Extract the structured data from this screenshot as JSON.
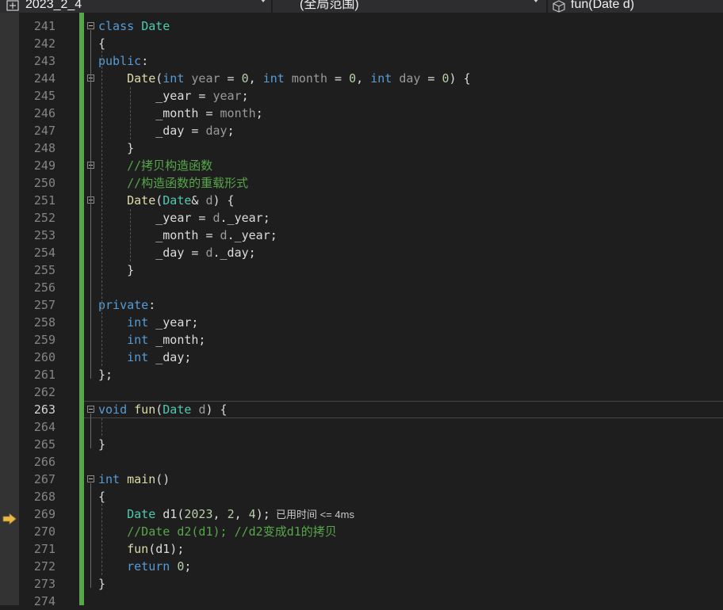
{
  "navbar": {
    "project": "2023_2_4",
    "scope": "(全局范围)",
    "member": "fun(Date d)"
  },
  "editor": {
    "current_line": 263,
    "execution_line": 269,
    "elapsed_hint": "已用时间 <= 4ms",
    "lines": [
      {
        "no": "241",
        "tokens": [
          [
            "kw",
            "class"
          ],
          [
            "pl",
            " "
          ],
          [
            "ty",
            "Date"
          ]
        ]
      },
      {
        "no": "242",
        "tokens": [
          [
            "pl",
            "{"
          ]
        ]
      },
      {
        "no": "243",
        "tokens": [
          [
            "kw",
            "public"
          ],
          [
            "pl",
            ":"
          ]
        ]
      },
      {
        "no": "244",
        "tokens": [
          [
            "pl",
            "    "
          ],
          [
            "fn",
            "Date"
          ],
          [
            "pl",
            "("
          ],
          [
            "kw",
            "int"
          ],
          [
            "pl",
            " "
          ],
          [
            "pm",
            "year"
          ],
          [
            "pl",
            " = "
          ],
          [
            "nm",
            "0"
          ],
          [
            "pl",
            ", "
          ],
          [
            "kw",
            "int"
          ],
          [
            "pl",
            " "
          ],
          [
            "pm",
            "month"
          ],
          [
            "pl",
            " = "
          ],
          [
            "nm",
            "0"
          ],
          [
            "pl",
            ", "
          ],
          [
            "kw",
            "int"
          ],
          [
            "pl",
            " "
          ],
          [
            "pm",
            "day"
          ],
          [
            "pl",
            " = "
          ],
          [
            "nm",
            "0"
          ],
          [
            "pl",
            ") {"
          ]
        ]
      },
      {
        "no": "245",
        "tokens": [
          [
            "pl",
            "        _year = "
          ],
          [
            "pm",
            "year"
          ],
          [
            "pl",
            ";"
          ]
        ]
      },
      {
        "no": "246",
        "tokens": [
          [
            "pl",
            "        _month = "
          ],
          [
            "pm",
            "month"
          ],
          [
            "pl",
            ";"
          ]
        ]
      },
      {
        "no": "247",
        "tokens": [
          [
            "pl",
            "        _day = "
          ],
          [
            "pm",
            "day"
          ],
          [
            "pl",
            ";"
          ]
        ]
      },
      {
        "no": "248",
        "tokens": [
          [
            "pl",
            "    }"
          ]
        ]
      },
      {
        "no": "249",
        "tokens": [
          [
            "pl",
            "    "
          ],
          [
            "cm",
            "//拷贝构造函数"
          ]
        ]
      },
      {
        "no": "250",
        "tokens": [
          [
            "pl",
            "    "
          ],
          [
            "cm",
            "//构造函数的重载形式"
          ]
        ]
      },
      {
        "no": "251",
        "tokens": [
          [
            "pl",
            "    "
          ],
          [
            "fn",
            "Date"
          ],
          [
            "pl",
            "("
          ],
          [
            "ty",
            "Date"
          ],
          [
            "pl",
            "& "
          ],
          [
            "pm",
            "d"
          ],
          [
            "pl",
            ") {"
          ]
        ]
      },
      {
        "no": "252",
        "tokens": [
          [
            "pl",
            "        _year = "
          ],
          [
            "pm",
            "d"
          ],
          [
            "pl",
            "._year;"
          ]
        ]
      },
      {
        "no": "253",
        "tokens": [
          [
            "pl",
            "        _month = "
          ],
          [
            "pm",
            "d"
          ],
          [
            "pl",
            "._year;"
          ]
        ]
      },
      {
        "no": "254",
        "tokens": [
          [
            "pl",
            "        _day = "
          ],
          [
            "pm",
            "d"
          ],
          [
            "pl",
            "._day;"
          ]
        ]
      },
      {
        "no": "255",
        "tokens": [
          [
            "pl",
            "    }"
          ]
        ]
      },
      {
        "no": "256",
        "tokens": []
      },
      {
        "no": "257",
        "tokens": [
          [
            "kw",
            "private"
          ],
          [
            "pl",
            ":"
          ]
        ]
      },
      {
        "no": "258",
        "tokens": [
          [
            "pl",
            "    "
          ],
          [
            "kw",
            "int"
          ],
          [
            "pl",
            " _year;"
          ]
        ]
      },
      {
        "no": "259",
        "tokens": [
          [
            "pl",
            "    "
          ],
          [
            "kw",
            "int"
          ],
          [
            "pl",
            " _month;"
          ]
        ]
      },
      {
        "no": "260",
        "tokens": [
          [
            "pl",
            "    "
          ],
          [
            "kw",
            "int"
          ],
          [
            "pl",
            " _day;"
          ]
        ]
      },
      {
        "no": "261",
        "tokens": [
          [
            "pl",
            "};"
          ]
        ]
      },
      {
        "no": "262",
        "tokens": []
      },
      {
        "no": "263",
        "tokens": [
          [
            "kw",
            "void"
          ],
          [
            "pl",
            " "
          ],
          [
            "fn",
            "fun"
          ],
          [
            "pl",
            "("
          ],
          [
            "ty",
            "Date"
          ],
          [
            "pl",
            " "
          ],
          [
            "pm",
            "d"
          ],
          [
            "pl",
            ") {"
          ]
        ]
      },
      {
        "no": "264",
        "tokens": []
      },
      {
        "no": "265",
        "tokens": [
          [
            "pl",
            "}"
          ]
        ]
      },
      {
        "no": "266",
        "tokens": []
      },
      {
        "no": "267",
        "tokens": [
          [
            "kw",
            "int"
          ],
          [
            "pl",
            " "
          ],
          [
            "fn",
            "main"
          ],
          [
            "pl",
            "()"
          ]
        ]
      },
      {
        "no": "268",
        "tokens": [
          [
            "pl",
            "{"
          ]
        ]
      },
      {
        "no": "269",
        "tokens": [
          [
            "pl",
            "    "
          ],
          [
            "ty",
            "Date"
          ],
          [
            "pl",
            " d1("
          ],
          [
            "nm",
            "2023"
          ],
          [
            "pl",
            ", "
          ],
          [
            "nm",
            "2"
          ],
          [
            "pl",
            ", "
          ],
          [
            "nm",
            "4"
          ],
          [
            "pl",
            ");"
          ]
        ]
      },
      {
        "no": "270",
        "tokens": [
          [
            "pl",
            "    "
          ],
          [
            "cm",
            "//Date d2(d1); //d2变成d1的拷贝"
          ]
        ]
      },
      {
        "no": "271",
        "tokens": [
          [
            "pl",
            "    "
          ],
          [
            "fn",
            "fun"
          ],
          [
            "pl",
            "(d1);"
          ]
        ]
      },
      {
        "no": "272",
        "tokens": [
          [
            "pl",
            "    "
          ],
          [
            "kw",
            "return"
          ],
          [
            "pl",
            " "
          ],
          [
            "nm",
            "0"
          ],
          [
            "pl",
            ";"
          ]
        ]
      },
      {
        "no": "273",
        "tokens": [
          [
            "pl",
            "}"
          ]
        ]
      },
      {
        "no": "274",
        "tokens": []
      }
    ]
  }
}
